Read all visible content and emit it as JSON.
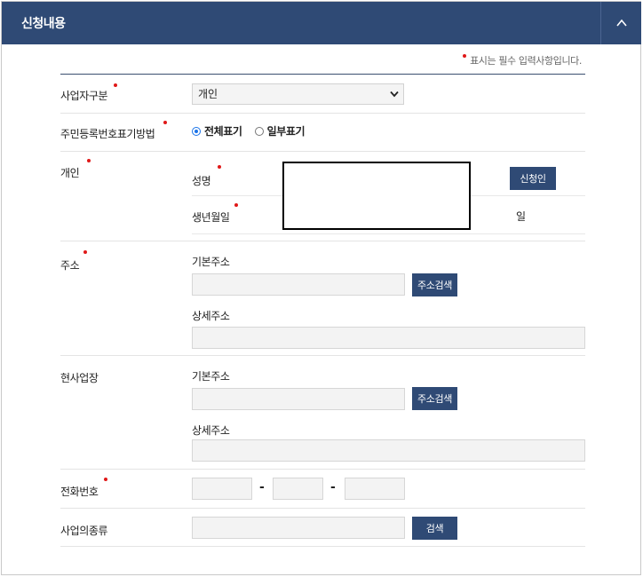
{
  "header": {
    "title": "신청내용"
  },
  "required_note": "표시는 필수 입력사항입니다.",
  "rows": {
    "business_type": {
      "label": "사업자구분",
      "selected": "개인"
    },
    "id_display": {
      "label": "주민등록번호표기방법",
      "options": [
        {
          "label": "전체표기",
          "checked": true
        },
        {
          "label": "일부표기",
          "checked": false
        }
      ]
    },
    "individual": {
      "label": "개인",
      "name_label": "성명",
      "applicant_button": "신청인",
      "birth_label": "생년월일",
      "day_suffix": "일"
    },
    "address": {
      "label": "주소",
      "base_label": "기본주소",
      "search_button": "주소검색",
      "detail_label": "상세주소"
    },
    "workplace": {
      "label": "현사업장",
      "base_label": "기본주소",
      "search_button": "주소검색",
      "detail_label": "상세주소"
    },
    "phone": {
      "label": "전화번호",
      "separator": "-"
    },
    "business_category": {
      "label": "사업의종류",
      "search_button": "검색"
    }
  }
}
